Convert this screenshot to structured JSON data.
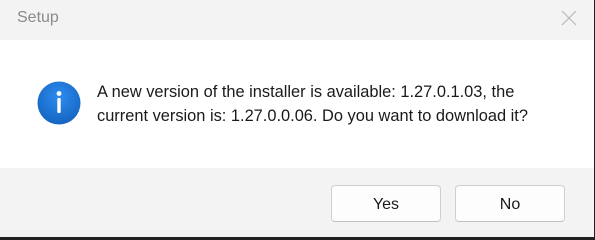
{
  "window": {
    "title": "Setup",
    "close_icon": "close-icon"
  },
  "message": {
    "icon": "info-icon",
    "text": "A new version of the installer is available: 1.27.0.1.03, the current version is: 1.27.0.0.06. Do you want to download it?"
  },
  "buttons": {
    "yes_label": "Yes",
    "no_label": "No"
  },
  "colors": {
    "info_blue": "#1a73d6",
    "dialog_bg": "#f3f3f3",
    "content_bg": "#ffffff"
  }
}
